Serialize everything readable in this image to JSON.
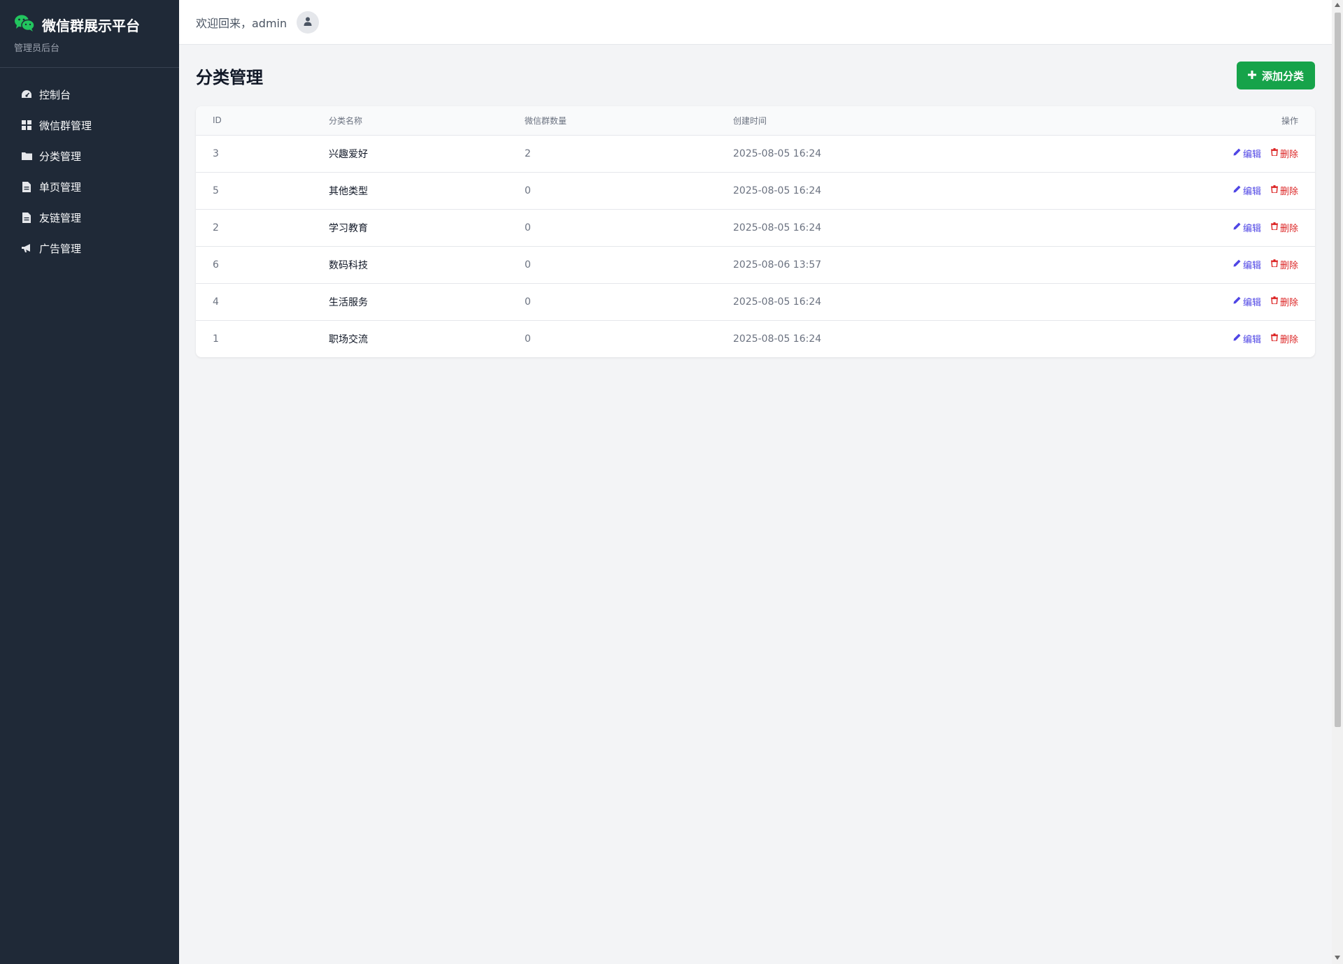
{
  "sidebar": {
    "brand_title": "微信群展示平台",
    "brand_subtitle": "管理员后台",
    "brand_icon": "wechat-icon",
    "brand_color": "#22c55e",
    "items": [
      {
        "label": "控制台",
        "icon": "dashboard-icon"
      },
      {
        "label": "微信群管理",
        "icon": "grid-icon"
      },
      {
        "label": "分类管理",
        "icon": "folder-icon"
      },
      {
        "label": "单页管理",
        "icon": "file-icon"
      },
      {
        "label": "友链管理",
        "icon": "file-icon"
      },
      {
        "label": "广告管理",
        "icon": "megaphone-icon"
      }
    ]
  },
  "header": {
    "welcome": "欢迎回来，admin",
    "avatar_icon": "user-icon"
  },
  "main": {
    "title": "分类管理",
    "add_button": "添加分类",
    "table": {
      "columns": [
        "ID",
        "分类名称",
        "微信群数量",
        "创建时间",
        "操作"
      ],
      "rows": [
        {
          "id": "3",
          "name": "兴趣爱好",
          "count": "2",
          "created": "2025-08-05 16:24"
        },
        {
          "id": "5",
          "name": "其他类型",
          "count": "0",
          "created": "2025-08-05 16:24"
        },
        {
          "id": "2",
          "name": "学习教育",
          "count": "0",
          "created": "2025-08-05 16:24"
        },
        {
          "id": "6",
          "name": "数码科技",
          "count": "0",
          "created": "2025-08-06 13:57"
        },
        {
          "id": "4",
          "name": "生活服务",
          "count": "0",
          "created": "2025-08-05 16:24"
        },
        {
          "id": "1",
          "name": "职场交流",
          "count": "0",
          "created": "2025-08-05 16:24"
        }
      ],
      "edit_label": "编辑",
      "delete_label": "删除"
    }
  },
  "colors": {
    "sidebar_bg": "#1f2937",
    "accent_green": "#16a34a",
    "edit": "#4f46e5",
    "delete": "#dc2626"
  }
}
